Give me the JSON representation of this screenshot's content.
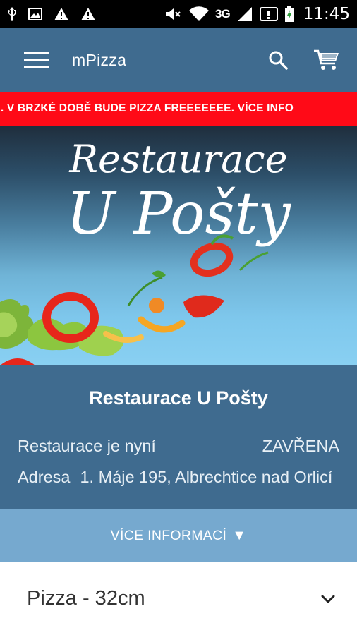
{
  "status_bar": {
    "time": "11:45",
    "network": "3G",
    "icons": [
      "usb-icon",
      "image-icon",
      "warning-icon",
      "warning-icon",
      "mute-icon",
      "wifi-icon",
      "signal-icon",
      "sim-icon",
      "battery-icon"
    ]
  },
  "app_bar": {
    "title": "mPizza",
    "icons": [
      "menu-icon",
      "search-icon",
      "cart-icon"
    ]
  },
  "marquee": {
    "text": "TE SI NÁŠ WEB. V BRZKÉ DOBĚ BUDE PIZZA FREEEEEEE. VÍCE INFO"
  },
  "banner": {
    "line1": "Restaurace",
    "line2": "U Pošty"
  },
  "info": {
    "title": "Restaurace U Pošty",
    "status_label": "Restaurace je nyní",
    "status_value": "ZAVŘENA",
    "address_label": "Adresa",
    "address_value": "1. Máje 195, Albrechtice nad Orlicí"
  },
  "more_info": {
    "label": "VÍCE INFORMACÍ",
    "arrow": "▼"
  },
  "category": {
    "label": "Pizza - 32cm",
    "icon": "chevron-down-icon"
  },
  "colors": {
    "primary": "#3f6b8f",
    "accent_light": "#76a9cf",
    "marquee": "#ff0a17"
  }
}
